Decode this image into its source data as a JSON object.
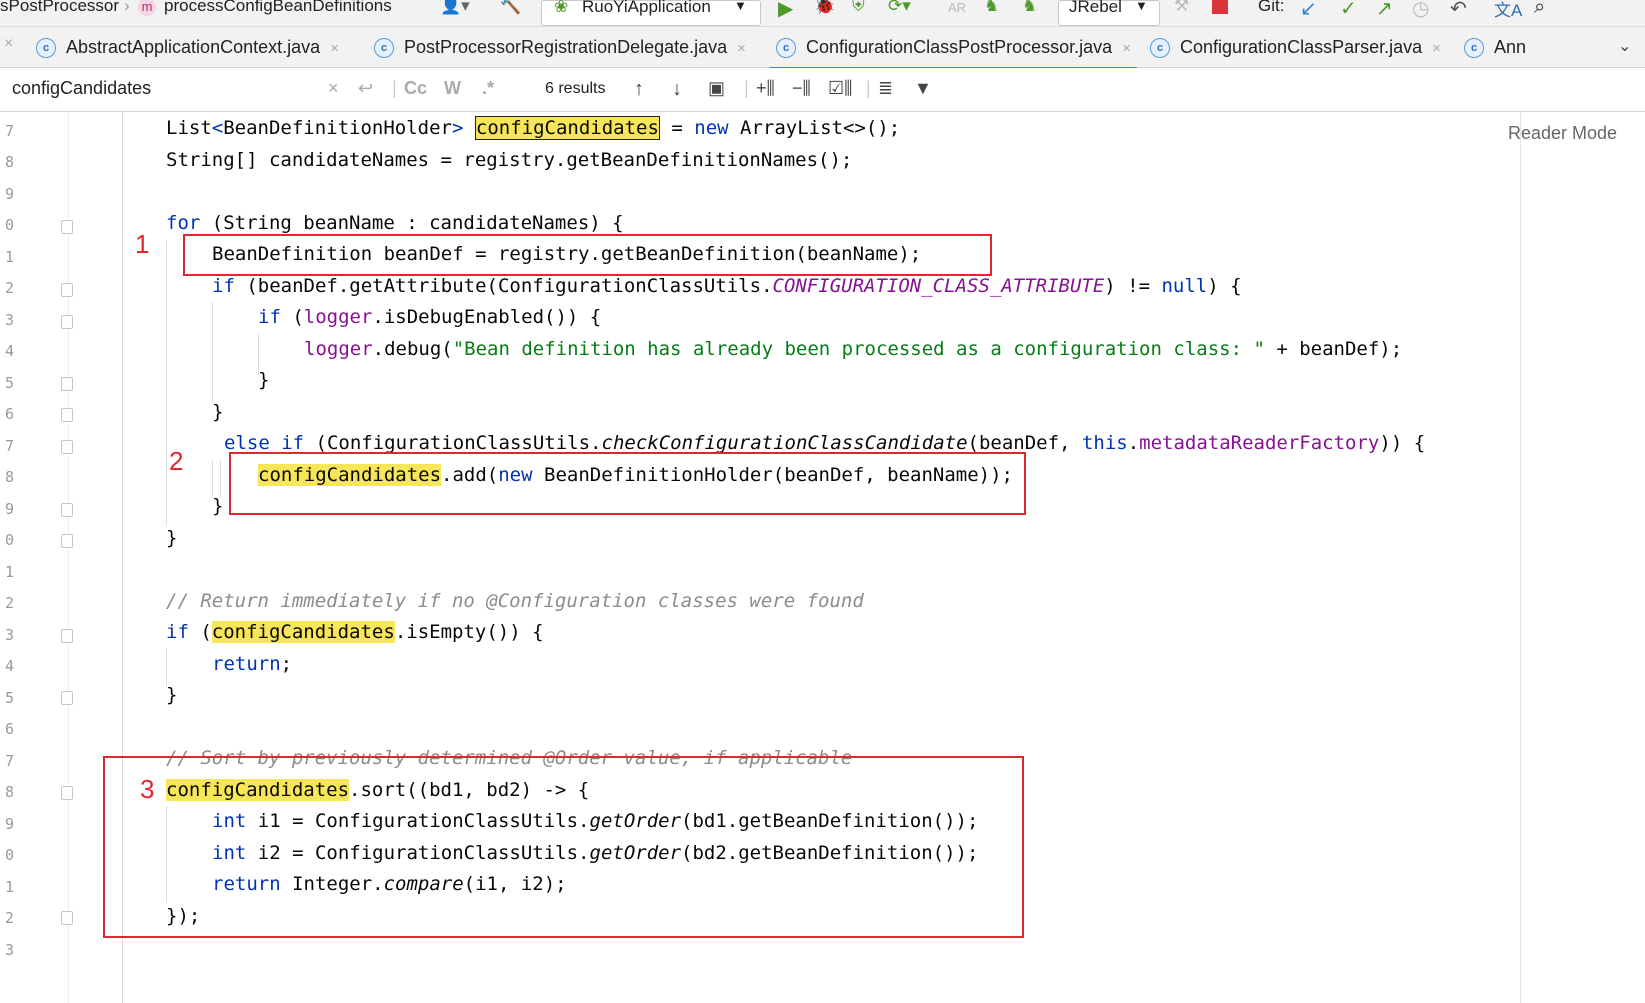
{
  "toolbar": {
    "breadcrumb_class": "sPostProcessor",
    "breadcrumb_method_badge": "m",
    "breadcrumb_method": "processConfigBeanDefinitions",
    "run_config": "RuoYiApplication",
    "jrebel": "JRebel",
    "git_label": "Git:"
  },
  "tabs": [
    {
      "label": "AbstractApplicationContext.java"
    },
    {
      "label": "PostProcessorRegistrationDelegate.java"
    },
    {
      "label": "ConfigurationClassPostProcessor.java"
    },
    {
      "label": "ConfigurationClassParser.java"
    },
    {
      "label": "Ann"
    }
  ],
  "search": {
    "query": "configCandidates",
    "case_label": "Cc",
    "word_label": "W",
    "regex_label": ".*",
    "results": "6 results"
  },
  "editor": {
    "reader_mode": "Reader Mode",
    "line_numbers": [
      "7",
      "8",
      "9",
      "0",
      "1",
      "2",
      "3",
      "4",
      "5",
      "6",
      "7",
      "8",
      "9",
      "0",
      "1",
      "2",
      "3",
      "4",
      "5",
      "6",
      "7",
      "8",
      "9",
      "0",
      "1",
      "2",
      "3"
    ]
  },
  "annotations": {
    "marker1": "1",
    "marker2": "2",
    "marker3": "3"
  },
  "code": {
    "l1_type": "List",
    "l1_lt": "<",
    "l1_generic": "BeanDefinitionHolder",
    "l1_gt": ">",
    "l1_var": "configCandidates",
    "l1_eq": " = ",
    "l1_new": "new",
    "l1_rest": " ArrayList<>();",
    "l2": "String[] candidateNames = registry.getBeanDefinitionNames();",
    "l4_for": "for",
    "l4_rest": " (String beanName : candidateNames) {",
    "l5": "BeanDefinition beanDef = registry.getBeanDefinition(beanName);",
    "l6_if": "if",
    "l6_a": " (beanDef.getAttribute(ConfigurationClassUtils.",
    "l6_const": "CONFIGURATION_CLASS_ATTRIBUTE",
    "l6_b": ") != ",
    "l6_null": "null",
    "l6_c": ") {",
    "l7_if": "if",
    "l7_a": " (",
    "l7_logger": "logger",
    "l7_b": ".isDebugEnabled()) {",
    "l8_logger": "logger",
    "l8_a": ".debug(",
    "l8_str": "\"Bean definition has already been processed as a configuration class: \"",
    "l8_b": " + beanDef);",
    "l9": "}",
    "l10": "}",
    "l11_else": "else if",
    "l11_a": " (ConfigurationClassUtils.",
    "l11_method": "checkConfigurationClassCandidate",
    "l11_b": "(beanDef, ",
    "l11_this": "this",
    "l11_dot": ".",
    "l11_field": "metadataReaderFactory",
    "l11_c": ")) {",
    "l12_var": "configCandidates",
    "l12_a": ".add(",
    "l12_new": "new",
    "l12_b": " BeanDefinitionHolder(beanDef, beanName));",
    "l13": "}",
    "l14": "}",
    "l16_comment": "// Return immediately if no @Configuration classes were found",
    "l17_if": "if",
    "l17_a": " (",
    "l17_var": "configCandidates",
    "l17_b": ".isEmpty()) {",
    "l18_return": "return",
    "l18_semi": ";",
    "l19": "}",
    "l21_comment": "// Sort by previously determined @Order value, if applicable",
    "l22_var": "configCandidates",
    "l22_rest": ".sort((bd1, bd2) -> {",
    "l23_int": "int",
    "l23_a": " i1 = ConfigurationClassUtils.",
    "l23_method": "getOrder",
    "l23_b": "(bd1.getBeanDefinition());",
    "l24_int": "int",
    "l24_a": " i2 = ConfigurationClassUtils.",
    "l24_method": "getOrder",
    "l24_b": "(bd2.getBeanDefinition());",
    "l25_return": "return",
    "l25_a": " Integer.",
    "l25_method": "compare",
    "l25_b": "(i1, i2);",
    "l26": "});"
  }
}
